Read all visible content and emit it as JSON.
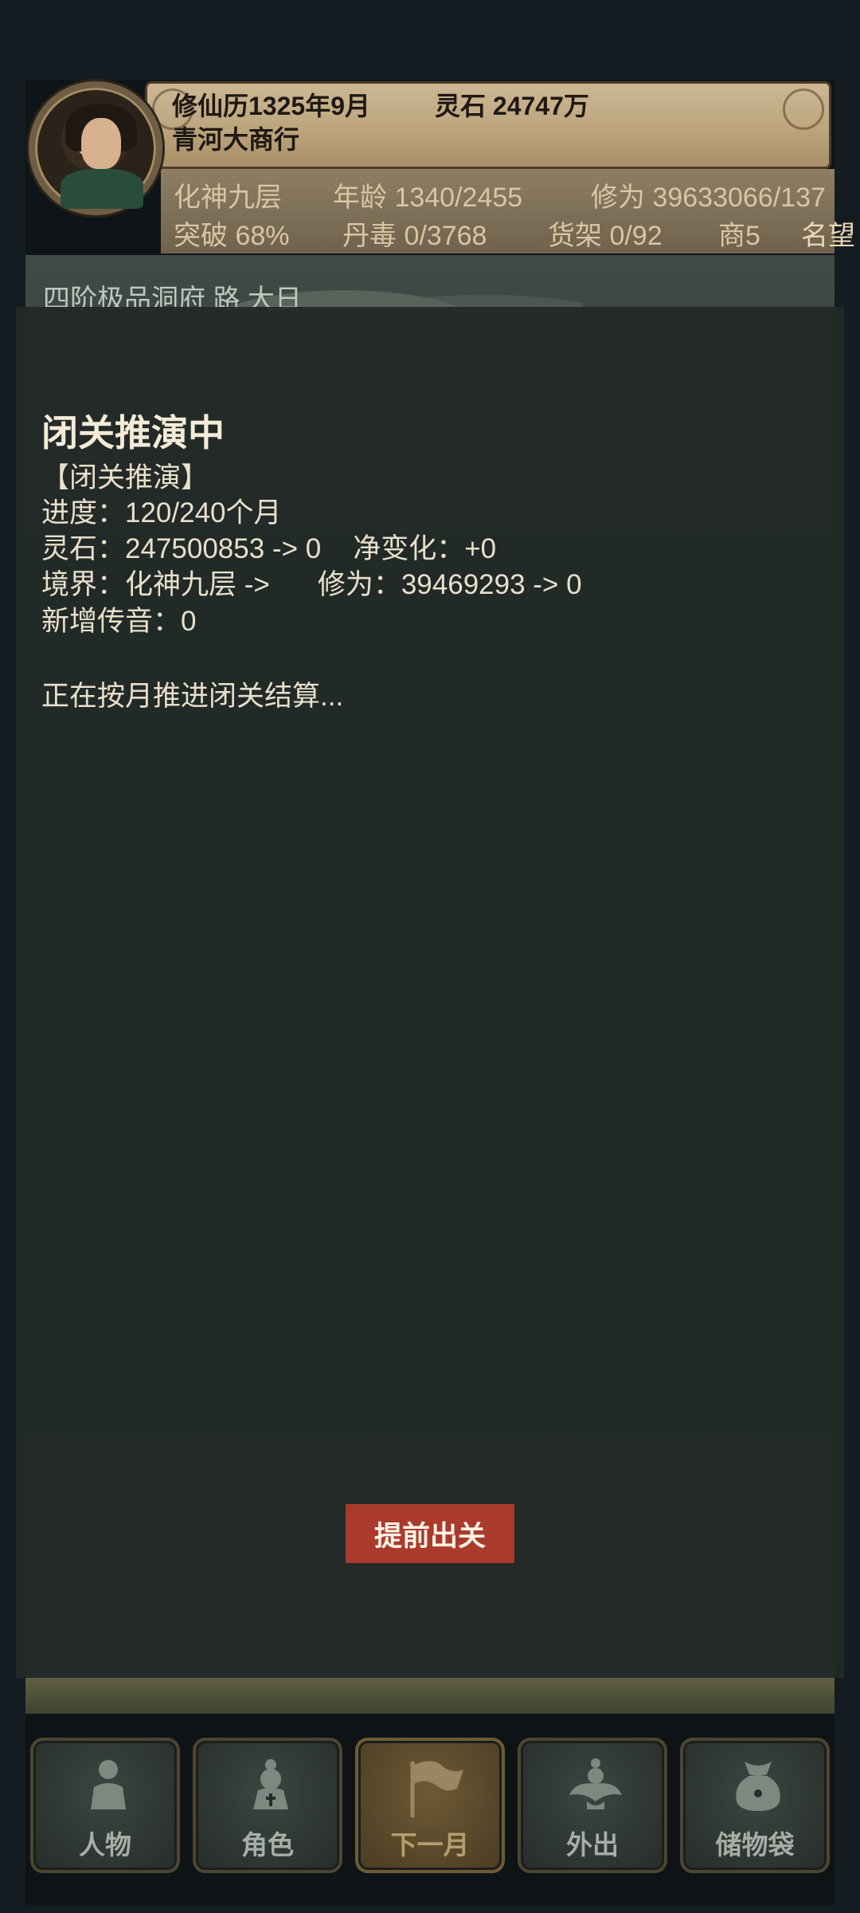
{
  "header": {
    "date": "修仙历1325年9月",
    "spirit_stones": "灵石 24747万",
    "shop_name": "青河大商行",
    "stats_row1": {
      "realm": "化神九层",
      "age": "年龄 1340/2455",
      "cultivation": "修为 39633066/137"
    },
    "stats_row2": {
      "breakthrough": "突破 68%",
      "pill_toxicity": "丹毒 0/3768",
      "shelves": "货架 0/92",
      "merchant": "商5",
      "reputation": "名望"
    }
  },
  "map": {
    "title": "四阶极品洞府 路 大日"
  },
  "dialog": {
    "title": "闭关推演中",
    "subtitle": "【闭关推演】",
    "progress": "进度：120/240个月",
    "spirit_stones": "灵石：247500853 -> 0",
    "net_change": "净变化：+0",
    "realm": "境界：化神九层 ->",
    "cultivation": "修为：39469293 -> 0",
    "new_messages": "新增传音：0",
    "status": "正在按月推进闭关结算...",
    "exit_button": "提前出关"
  },
  "nav": {
    "items": [
      {
        "label": "人物",
        "icon": "person-icon"
      },
      {
        "label": "角色",
        "icon": "character-icon"
      },
      {
        "label": "下一月",
        "icon": "flag-icon"
      },
      {
        "label": "外出",
        "icon": "travel-icon"
      },
      {
        "label": "储物袋",
        "icon": "storage-bag-icon"
      }
    ]
  },
  "colors": {
    "dialog_bg": "#222927",
    "exit_button": "#a93a2c",
    "scroll": "#c5b08b"
  }
}
